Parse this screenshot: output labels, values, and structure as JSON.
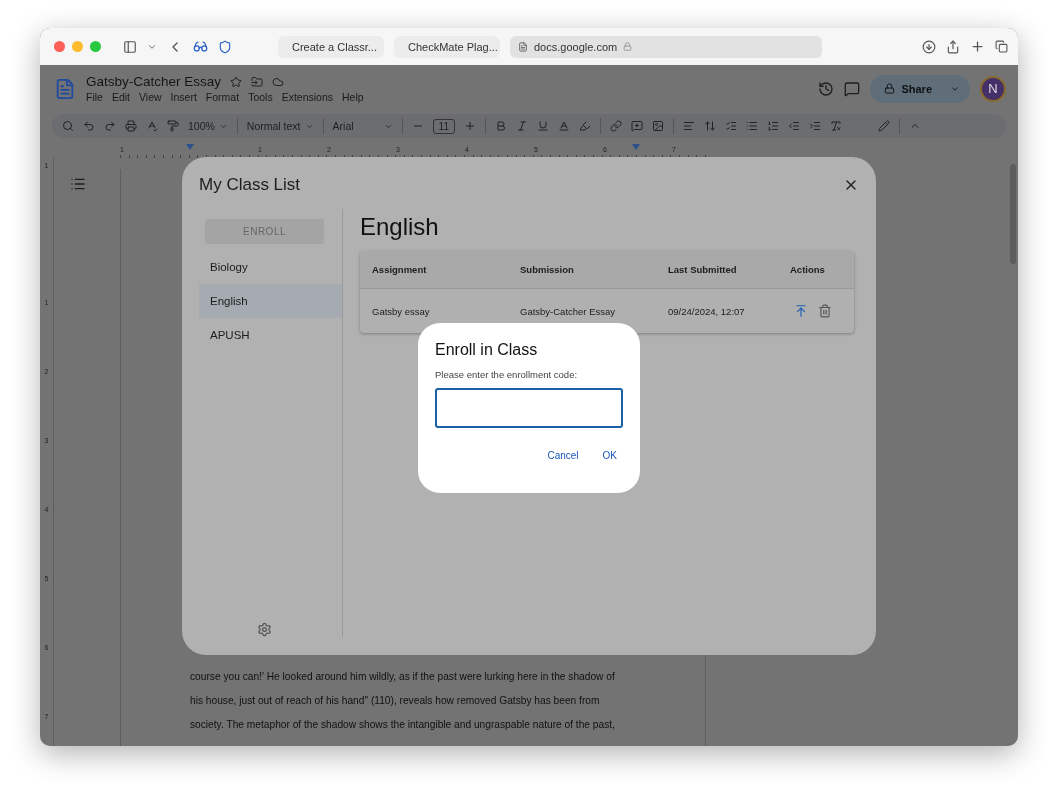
{
  "browser": {
    "tabs": [
      {
        "title": "Create a Classr...",
        "selected": false
      },
      {
        "title": "CheckMate Plag...",
        "selected": false
      },
      {
        "title": "docs.google.com",
        "selected": true
      }
    ]
  },
  "doc": {
    "title": "Gatsby-Catcher Essay",
    "menus": [
      "File",
      "Edit",
      "View",
      "Insert",
      "Format",
      "Tools",
      "Extensions",
      "Help"
    ],
    "share": "Share",
    "avatar": "N",
    "toolbar": {
      "zoom": "100%",
      "style": "Normal text",
      "font": "Arial",
      "font_size": "11"
    },
    "ruler_h": [
      "1",
      "1",
      "2",
      "3",
      "4",
      "5",
      "6",
      "7"
    ],
    "ruler_v": [
      "1",
      "1",
      "2",
      "3",
      "4",
      "5",
      "6",
      "7"
    ],
    "body": [
      "course you can!' He looked around him wildly, as if the past were lurking here in the shadow of",
      "his house, just out of reach of his hand\" (110), reveals how removed Gatsby has been from",
      "society. The metaphor of the shadow shows the intangible and ungraspable nature of the past,"
    ]
  },
  "class_list": {
    "title": "My Class List",
    "enroll_button": {
      "label": "ENROLL",
      "disabled": true
    },
    "classes": [
      {
        "name": "Biology",
        "selected": false
      },
      {
        "name": "English",
        "selected": true
      },
      {
        "name": "APUSH",
        "selected": false
      }
    ],
    "heading": "English",
    "columns": [
      "Assignment",
      "Submission",
      "Last Submitted",
      "Actions"
    ],
    "rows": [
      {
        "assignment": "Gatsby essay",
        "submission": "Gatsby-Catcher Essay",
        "last_submitted": "09/24/2024, 12:07"
      }
    ]
  },
  "enroll": {
    "title": "Enroll in Class",
    "prompt": "Please enter the enrollment code:",
    "buttons": [
      "Cancel",
      "OK"
    ]
  }
}
